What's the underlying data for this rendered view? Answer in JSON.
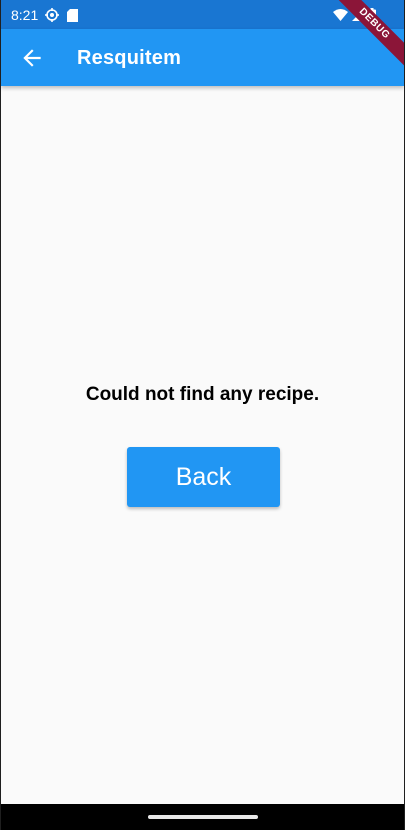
{
  "status_bar": {
    "time": "8:21",
    "left_icons": [
      "settings-icon",
      "sd-card-icon"
    ],
    "right_icons": [
      "wifi-icon",
      "signal-icon",
      "battery-icon"
    ]
  },
  "app_bar": {
    "title": "Resquitem",
    "back_icon": "arrow-back-icon",
    "background_color": "#2196f3"
  },
  "debug_banner": {
    "label": "DEBUG"
  },
  "main": {
    "message": "Could not find any recipe.",
    "back_button_label": "Back"
  },
  "colors": {
    "status_bar": "#1976d2",
    "primary": "#2196f3",
    "background": "#fafafa",
    "debug_ribbon": "#8b1538"
  }
}
